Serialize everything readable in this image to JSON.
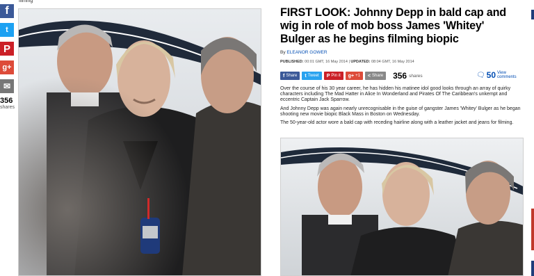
{
  "left_pane": {
    "top_caption": "filming",
    "share_rail": {
      "buttons": [
        {
          "name": "facebook",
          "glyph": "f",
          "color": "#3b5998"
        },
        {
          "name": "twitter",
          "glyph": "t",
          "color": "#1da1f2"
        },
        {
          "name": "pinterest",
          "glyph": "P",
          "color": "#cb2027"
        },
        {
          "name": "google-plus",
          "glyph": "g+",
          "color": "#dd4b39"
        },
        {
          "name": "email",
          "glyph": "✉",
          "color": "#777777"
        }
      ],
      "count": "356",
      "count_label": "shares"
    }
  },
  "article": {
    "headline": "FIRST LOOK: Johnny Depp in bald cap and wig in role of mob boss James 'Whitey' Bulger as he begins filming biopic",
    "byline_prefix": "By",
    "author": "ELEANOR GOWER",
    "published_label": "PUBLISHED:",
    "published": "00:01 GMT, 16 May 2014",
    "updated_label": "UPDATED:",
    "updated": "08:04 GMT, 16 May 2014",
    "share_bar": {
      "buttons": [
        {
          "name": "facebook",
          "glyph": "f",
          "label": "Share"
        },
        {
          "name": "twitter",
          "glyph": "t",
          "label": "Tweet"
        },
        {
          "name": "pinterest",
          "glyph": "P",
          "label": "Pin it"
        },
        {
          "name": "google-plus",
          "glyph": "g+",
          "label": "+1"
        },
        {
          "name": "share",
          "glyph": "<",
          "label": "Share"
        }
      ],
      "share_count": "356",
      "share_label": "shares",
      "comment_count": "50",
      "comment_label": "View comments"
    },
    "paragraphs": [
      "Over the course of his 30 year career, he has hidden his matinee idol good looks through an array of quirky characters including The Mad Hatter in Alice In Wonderland and Pirates Of The Caribbean's unkempt and eccentric Captain Jack Sparrow.",
      "And Johnny Depp was again nearly unrecognisable in the guise of gangster James 'Whitey' Bulger as he began shooting new movie biopic Black Mass in Boston on Wednesday.",
      "The 50-year-old actor wore a bald cap with receding hairline along with a leather jacket and jeans for filming."
    ]
  },
  "colors": {
    "accent_blue": "#004db3",
    "facebook": "#3b5998",
    "twitter": "#1da1f2",
    "pinterest": "#cb2027",
    "google_plus": "#dd4b39"
  }
}
